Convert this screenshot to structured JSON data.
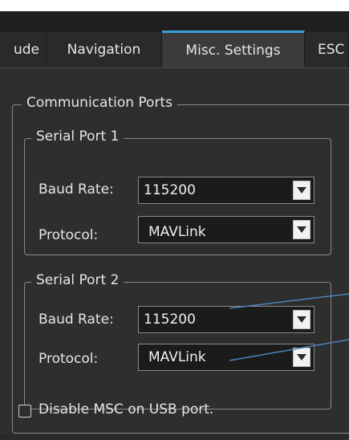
{
  "tabs": [
    {
      "label": "ude"
    },
    {
      "label": "Navigation"
    },
    {
      "label": "Misc. Settings"
    },
    {
      "label": "ESC"
    }
  ],
  "comm_group": {
    "title": "Communication Ports"
  },
  "serial1": {
    "title": "Serial Port 1",
    "baud_label": "Baud Rate:",
    "baud_value": "115200",
    "protocol_label": "Protocol:",
    "protocol_value": "MAVLink"
  },
  "serial2": {
    "title": "Serial Port 2",
    "baud_label": "Baud Rate:",
    "baud_value": "115200",
    "protocol_label": "Protocol:",
    "protocol_value": "MAVLink"
  },
  "msc_checkbox": {
    "label": "Disable MSC on USB port.",
    "checked": false
  },
  "colors": {
    "accent": "#3aa0d8",
    "annotation_line": "#4f84b8"
  }
}
